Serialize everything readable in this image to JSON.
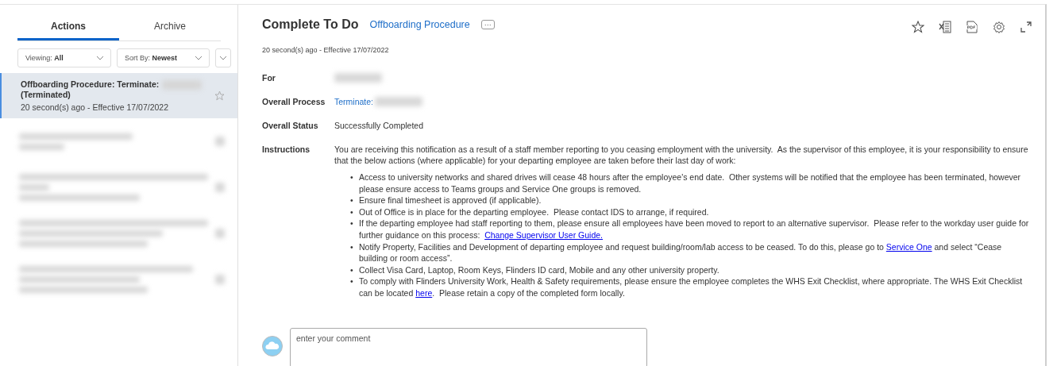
{
  "sidebar": {
    "tabs": [
      {
        "label": "Actions",
        "selected": true
      },
      {
        "label": "Archive",
        "selected": false
      }
    ],
    "filters": [
      {
        "label": "Viewing:",
        "value": "All"
      },
      {
        "label": "Sort By:",
        "value": "Newest"
      }
    ],
    "items": [
      {
        "kind": "task",
        "title": "Offboarding Procedure: Terminate:",
        "subtitle": "(Terminated)",
        "meta": "20 second(s) ago - Effective 17/07/2022",
        "selected": true
      },
      {
        "kind": "redacted",
        "selected": false
      },
      {
        "kind": "redacted",
        "selected": false
      },
      {
        "kind": "redacted",
        "selected": false
      },
      {
        "kind": "redacted",
        "selected": false
      }
    ]
  },
  "main": {
    "title": "Complete To Do",
    "process_link": "Offboarding Procedure",
    "more_button": "···",
    "meta": "20 second(s) ago -  Effective 17/07/2022",
    "fields": [
      {
        "kind": "redacted",
        "label": "For"
      },
      {
        "kind": "link",
        "label": "Overall Process",
        "value": "Terminate:"
      },
      {
        "kind": "text",
        "label": "Overall Status",
        "value": "Successfully Completed"
      },
      {
        "kind": "instructions",
        "label": "Instructions",
        "value": "You are receiving this notification as a result of a staff member reporting to you ceasing employment with the university.  As the supervisor of this employee, it is your responsibility to ensure that the below actions (where applicable) for your departing employee are taken before their last day of work:",
        "bullet_marker": "•",
        "bullets": [
          [
            {
              "kind": "text",
              "text": "Access to university networks and shared drives will cease 48 hours after the employee's end date.  Other systems will be notified that the employee has been terminated, however please ensure access to Teams groups and Service One groups is removed."
            }
          ],
          [
            {
              "kind": "text",
              "text": "Ensure final timesheet is approved (if applicable)."
            }
          ],
          [
            {
              "kind": "text",
              "text": "Out of Office is in place for the departing employee.  Please contact IDS to arrange, if required."
            }
          ],
          [
            {
              "kind": "text",
              "text": "If the departing employee had staff reporting to them, please ensure all employees have been moved to report to an alternative supervisor.  Please refer to the workday user guide for further guidance on this process:  "
            },
            {
              "kind": "link",
              "text": "Change Supervisor User Guide. "
            }
          ],
          [
            {
              "kind": "text",
              "text": "Notify Property, Facilities and Development of departing employee and request building/room/lab access to be ceased. To do this, please go to "
            },
            {
              "kind": "link",
              "text": "Service One"
            },
            {
              "kind": "text",
              "text": " and select “Cease building or room access”."
            }
          ],
          [
            {
              "kind": "text",
              "text": "Collect Visa Card, Laptop, Room Keys, Flinders ID card, Mobile and any other university property."
            }
          ],
          [
            {
              "kind": "text",
              "text": "To comply with Flinders University Work, Health & Safety requirements, please ensure the employee completes the WHS Exit Checklist, where appropriate. The WHS Exit Checklist can be located "
            },
            {
              "kind": "link",
              "text": "here"
            },
            {
              "kind": "text",
              "text": ".  Please retain a copy of the completed form locally."
            }
          ]
        ]
      }
    ],
    "comment": {
      "placeholder": "enter your comment"
    }
  }
}
